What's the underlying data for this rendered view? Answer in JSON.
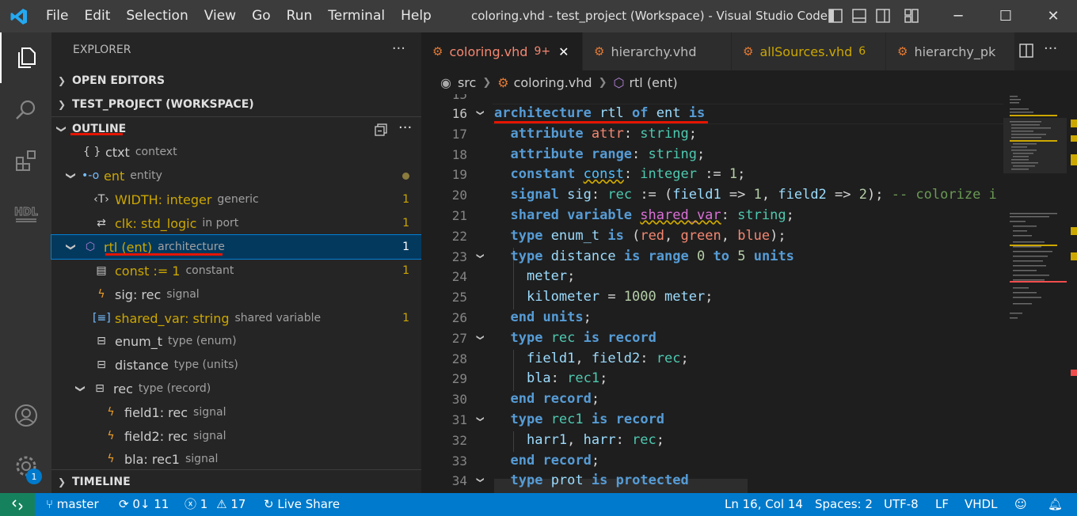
{
  "window": {
    "title": "coloring.vhd - test_project (Workspace) - Visual Studio Code",
    "menu": [
      "File",
      "Edit",
      "Selection",
      "View",
      "Go",
      "Run",
      "Terminal",
      "Help"
    ]
  },
  "activity": {
    "accounts_badge": "1",
    "hdl_label": "HDL"
  },
  "sidebar": {
    "header": "EXPLORER",
    "more": "···",
    "sections": {
      "open_editors": "OPEN EDITORS",
      "workspace": "TEST_PROJECT (WORKSPACE)",
      "outline": "OUTLINE",
      "timeline": "TIMELINE"
    },
    "outline": [
      {
        "icon": "{ }",
        "name": "ctxt",
        "desc": "context",
        "count": ""
      },
      {
        "icon": "•-o",
        "name": "ent",
        "desc": "entity",
        "count": ""
      },
      {
        "icon": "‹T›",
        "name": "WIDTH: integer",
        "desc": "generic",
        "count": "1"
      },
      {
        "icon": "⇄",
        "name": "clk: std_logic",
        "desc": "in port",
        "count": "1"
      },
      {
        "icon": "⬡",
        "name": "rtl (ent)",
        "desc": "architecture",
        "count": "1"
      },
      {
        "icon": "▤",
        "name": "const := 1",
        "desc": "constant",
        "count": "1"
      },
      {
        "icon": "ϟ",
        "name": "sig: rec",
        "desc": "signal",
        "count": ""
      },
      {
        "icon": "[≡]",
        "name": "shared_var: string",
        "desc": "shared variable",
        "count": "1"
      },
      {
        "icon": "⊟",
        "name": "enum_t",
        "desc": "type (enum)",
        "count": ""
      },
      {
        "icon": "⊟",
        "name": "distance",
        "desc": "type (units)",
        "count": ""
      },
      {
        "icon": "⊟",
        "name": "rec",
        "desc": "type (record)",
        "count": ""
      },
      {
        "icon": "ϟ",
        "name": "field1: rec",
        "desc": "signal",
        "count": ""
      },
      {
        "icon": "ϟ",
        "name": "field2: rec",
        "desc": "signal",
        "count": ""
      },
      {
        "icon": "ϟ",
        "name": "bla: rec1",
        "desc": "signal",
        "count": ""
      }
    ]
  },
  "tabs": [
    {
      "name": "coloring.vhd",
      "badge": "9+",
      "close": "✕"
    },
    {
      "name": "hierarchy.vhd",
      "badge": ""
    },
    {
      "name": "allSources.vhd",
      "badge": "6"
    },
    {
      "name": "hierarchy_pk",
      "badge": ""
    }
  ],
  "breadcrumb": {
    "folder": "src",
    "file": "coloring.vhd",
    "symbol": "rtl (ent)"
  },
  "code": {
    "top_partial_line": "15",
    "line_numbers": [
      "16",
      "17",
      "18",
      "19",
      "20",
      "21",
      "22",
      "23",
      "24",
      "25",
      "26",
      "27",
      "28",
      "29",
      "30",
      "31",
      "32",
      "33",
      "34"
    ],
    "lines": [
      "architecture rtl of ent is",
      "  attribute attr: string;",
      "  attribute range: string;",
      "  constant const: integer := 1;",
      "  signal sig: rec := (field1 => 1, field2 => 2); -- colorize i",
      "  shared variable shared_var: string;",
      "  type enum_t is (red, green, blue);",
      "  type distance is range 0 to 5 units",
      "    meter;",
      "    kilometer = 1000 meter;",
      "  end units;",
      "  type rec is record",
      "    field1, field2: rec;",
      "    bla: rec1;",
      "  end record;",
      "  type rec1 is record",
      "    harr1, harr: rec;",
      "  end record;",
      "  type prot is protected"
    ]
  },
  "status": {
    "branch": "master",
    "sync": "0↓ 11",
    "errors": "1",
    "warnings": "17",
    "live_share": "Live Share",
    "position": "Ln 16, Col 14",
    "spaces": "Spaces: 2",
    "encoding": "UTF-8",
    "eol": "LF",
    "language": "VHDL"
  },
  "colors": {
    "accent": "#007acc",
    "warning": "#cca700",
    "remote": "#16825d",
    "annotation": "#e51400"
  }
}
